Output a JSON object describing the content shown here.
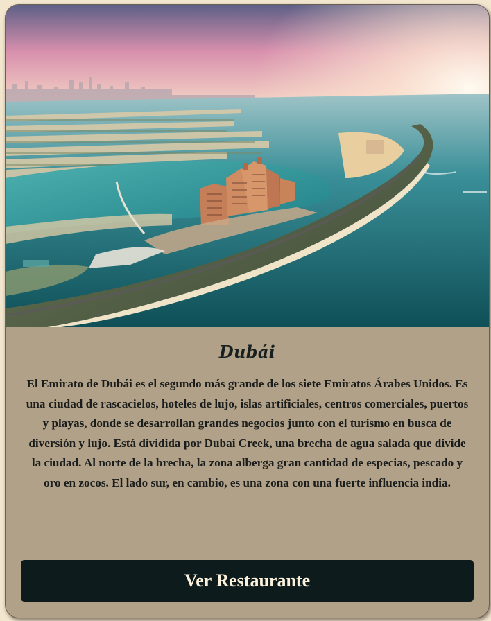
{
  "card": {
    "image": {
      "subject": "aerial-photo-palm-jumeirah-dubai",
      "colors": {
        "sky_top": "#6b6a8e",
        "sky_pink": "#e59ab0",
        "sun_glow": "#fff6df",
        "sea_deep": "#0f5a63",
        "sea_light": "#3a9ea5",
        "sand": "#e8c99a",
        "hotel": "#c98a62"
      }
    },
    "title": "Dubái",
    "description": "El Emirato de Dubái es el segundo más grande de los siete Emiratos Árabes Unidos. Es una ciudad de rascacielos, hoteles de lujo, islas artificiales, centros comerciales, puertos y playas, donde se desarrollan grandes negocios junto con el turismo en busca de diversión y lujo. Está dividida por Dubai Creek, una brecha de agua salada que divide la ciudad. Al norte de la brecha, la zona alberga gran cantidad de especias, pescado y oro en zocos. El lado sur, en cambio, es una zona con una fuerte influencia india.",
    "button_label": "Ver Restaurante",
    "colors": {
      "card_bg": "#b1a188",
      "button_bg": "#0e1b1c",
      "button_text": "#fbf1dc",
      "text": "#1a1d1c"
    }
  }
}
